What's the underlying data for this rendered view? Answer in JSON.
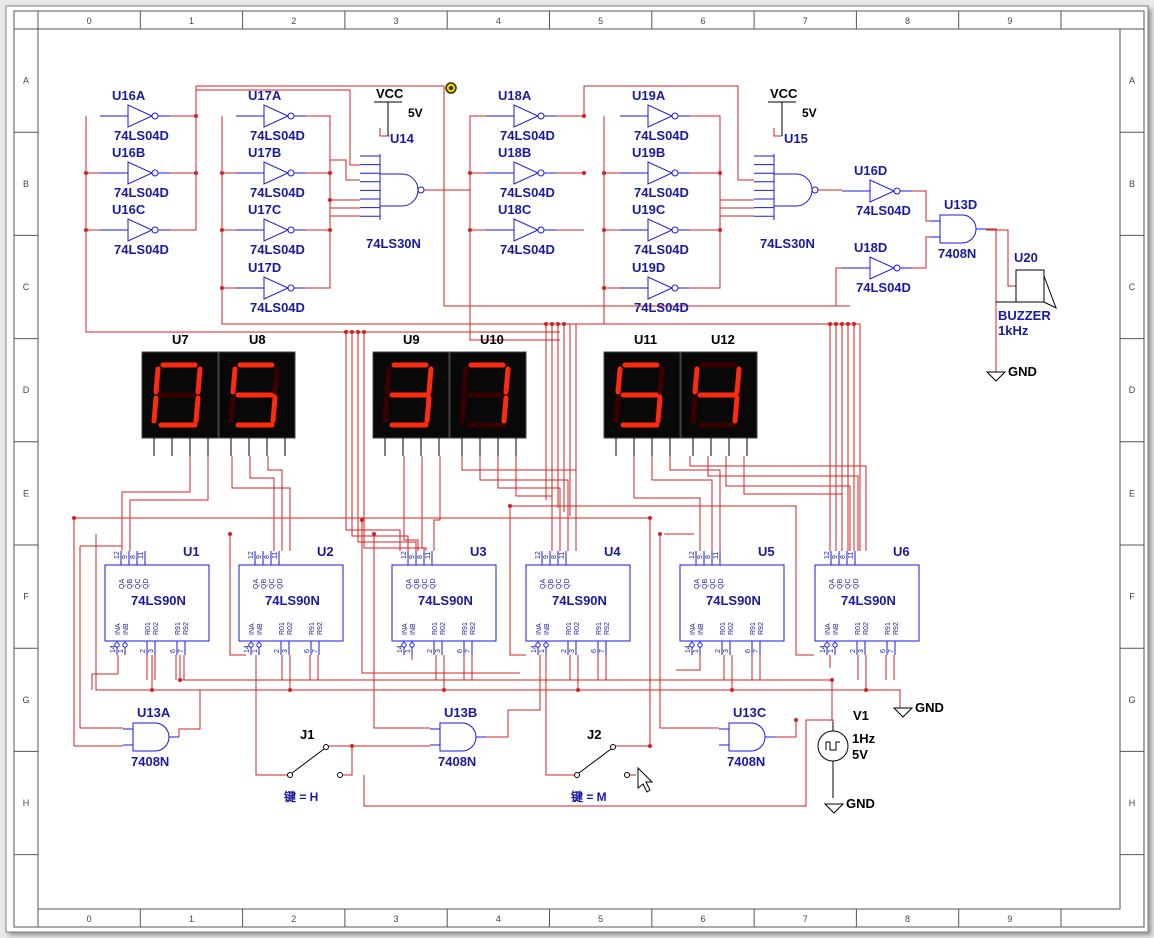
{
  "colors": {
    "wire": "#d42020",
    "component": "#1a1adc",
    "label": "#1a1aa0",
    "text": "#000000",
    "border": "#555555",
    "segment_on": "#ff2a10",
    "segment_off": "#3a0000",
    "display_bg": "#080808"
  },
  "icons": [
    "inverter-icon",
    "nand-gate-icon",
    "and-gate-icon",
    "counter-chip-icon",
    "seven-segment-display-icon",
    "spdt-switch-icon",
    "ac-source-icon",
    "ground-icon",
    "buzzer-icon",
    "probe-icon",
    "mouse-cursor-icon"
  ],
  "frame": {
    "columns": [
      "0",
      "1",
      "2",
      "3",
      "4",
      "5",
      "6",
      "7",
      "8",
      "9"
    ],
    "rows": [
      "A",
      "B",
      "C",
      "D",
      "E",
      "F",
      "G",
      "H"
    ]
  },
  "inverters": [
    {
      "ref": "U16A",
      "part": "74LS04D"
    },
    {
      "ref": "U16B",
      "part": "74LS04D"
    },
    {
      "ref": "U16C",
      "part": "74LS04D"
    },
    {
      "ref": "U17A",
      "part": "74LS04D"
    },
    {
      "ref": "U17B",
      "part": "74LS04D"
    },
    {
      "ref": "U17C",
      "part": "74LS04D"
    },
    {
      "ref": "U17D",
      "part": "74LS04D"
    },
    {
      "ref": "U18A",
      "part": "74LS04D"
    },
    {
      "ref": "U18B",
      "part": "74LS04D"
    },
    {
      "ref": "U18C",
      "part": "74LS04D"
    },
    {
      "ref": "U19A",
      "part": "74LS04D"
    },
    {
      "ref": "U19B",
      "part": "74LS04D"
    },
    {
      "ref": "U19C",
      "part": "74LS04D"
    },
    {
      "ref": "U19D",
      "part": "74LS04D"
    },
    {
      "ref": "U16D",
      "part": "74LS04D"
    },
    {
      "ref": "U18D",
      "part": "74LS04D"
    }
  ],
  "nand_gates": [
    {
      "ref": "U14",
      "part": "74LS30N"
    },
    {
      "ref": "U15",
      "part": "74LS30N"
    }
  ],
  "supplies": [
    {
      "name": "VCC",
      "value": "5V"
    },
    {
      "name": "VCC",
      "value": "5V"
    }
  ],
  "and_gates": [
    {
      "ref": "U13D",
      "part": "7408N"
    },
    {
      "ref": "U13A",
      "part": "7408N"
    },
    {
      "ref": "U13B",
      "part": "7408N"
    },
    {
      "ref": "U13C",
      "part": "7408N"
    }
  ],
  "buzzer": {
    "ref": "U20",
    "name": "BUZZER",
    "freq": "1kHz"
  },
  "grounds": [
    "GND",
    "GND",
    "GND"
  ],
  "displays": [
    {
      "ref": "U7",
      "digit": "0"
    },
    {
      "ref": "U8",
      "digit": "5"
    },
    {
      "ref": "U9",
      "digit": "3"
    },
    {
      "ref": "U10",
      "digit": "7"
    },
    {
      "ref": "U11",
      "digit": "5"
    },
    {
      "ref": "U12",
      "digit": "4"
    }
  ],
  "counters": [
    {
      "ref": "U1",
      "part": "74LS90N"
    },
    {
      "ref": "U2",
      "part": "74LS90N"
    },
    {
      "ref": "U3",
      "part": "74LS90N"
    },
    {
      "ref": "U4",
      "part": "74LS90N"
    },
    {
      "ref": "U5",
      "part": "74LS90N"
    },
    {
      "ref": "U6",
      "part": "74LS90N"
    }
  ],
  "counter_pins": {
    "top_nums": [
      "12",
      "9",
      "8",
      "11"
    ],
    "top_labels": [
      "QA",
      "QB",
      "QC",
      "QD"
    ],
    "bottom_labels": [
      "INA",
      "INB",
      "R01",
      "R02",
      "R91",
      "R92"
    ],
    "bottom_nums": [
      "14",
      "1",
      "2",
      "3",
      "6",
      "7"
    ]
  },
  "switches": [
    {
      "ref": "J1",
      "key": "键 = H"
    },
    {
      "ref": "J2",
      "key": "键 = M"
    }
  ],
  "source": {
    "ref": "V1",
    "freq": "1Hz",
    "volt": "5V"
  }
}
